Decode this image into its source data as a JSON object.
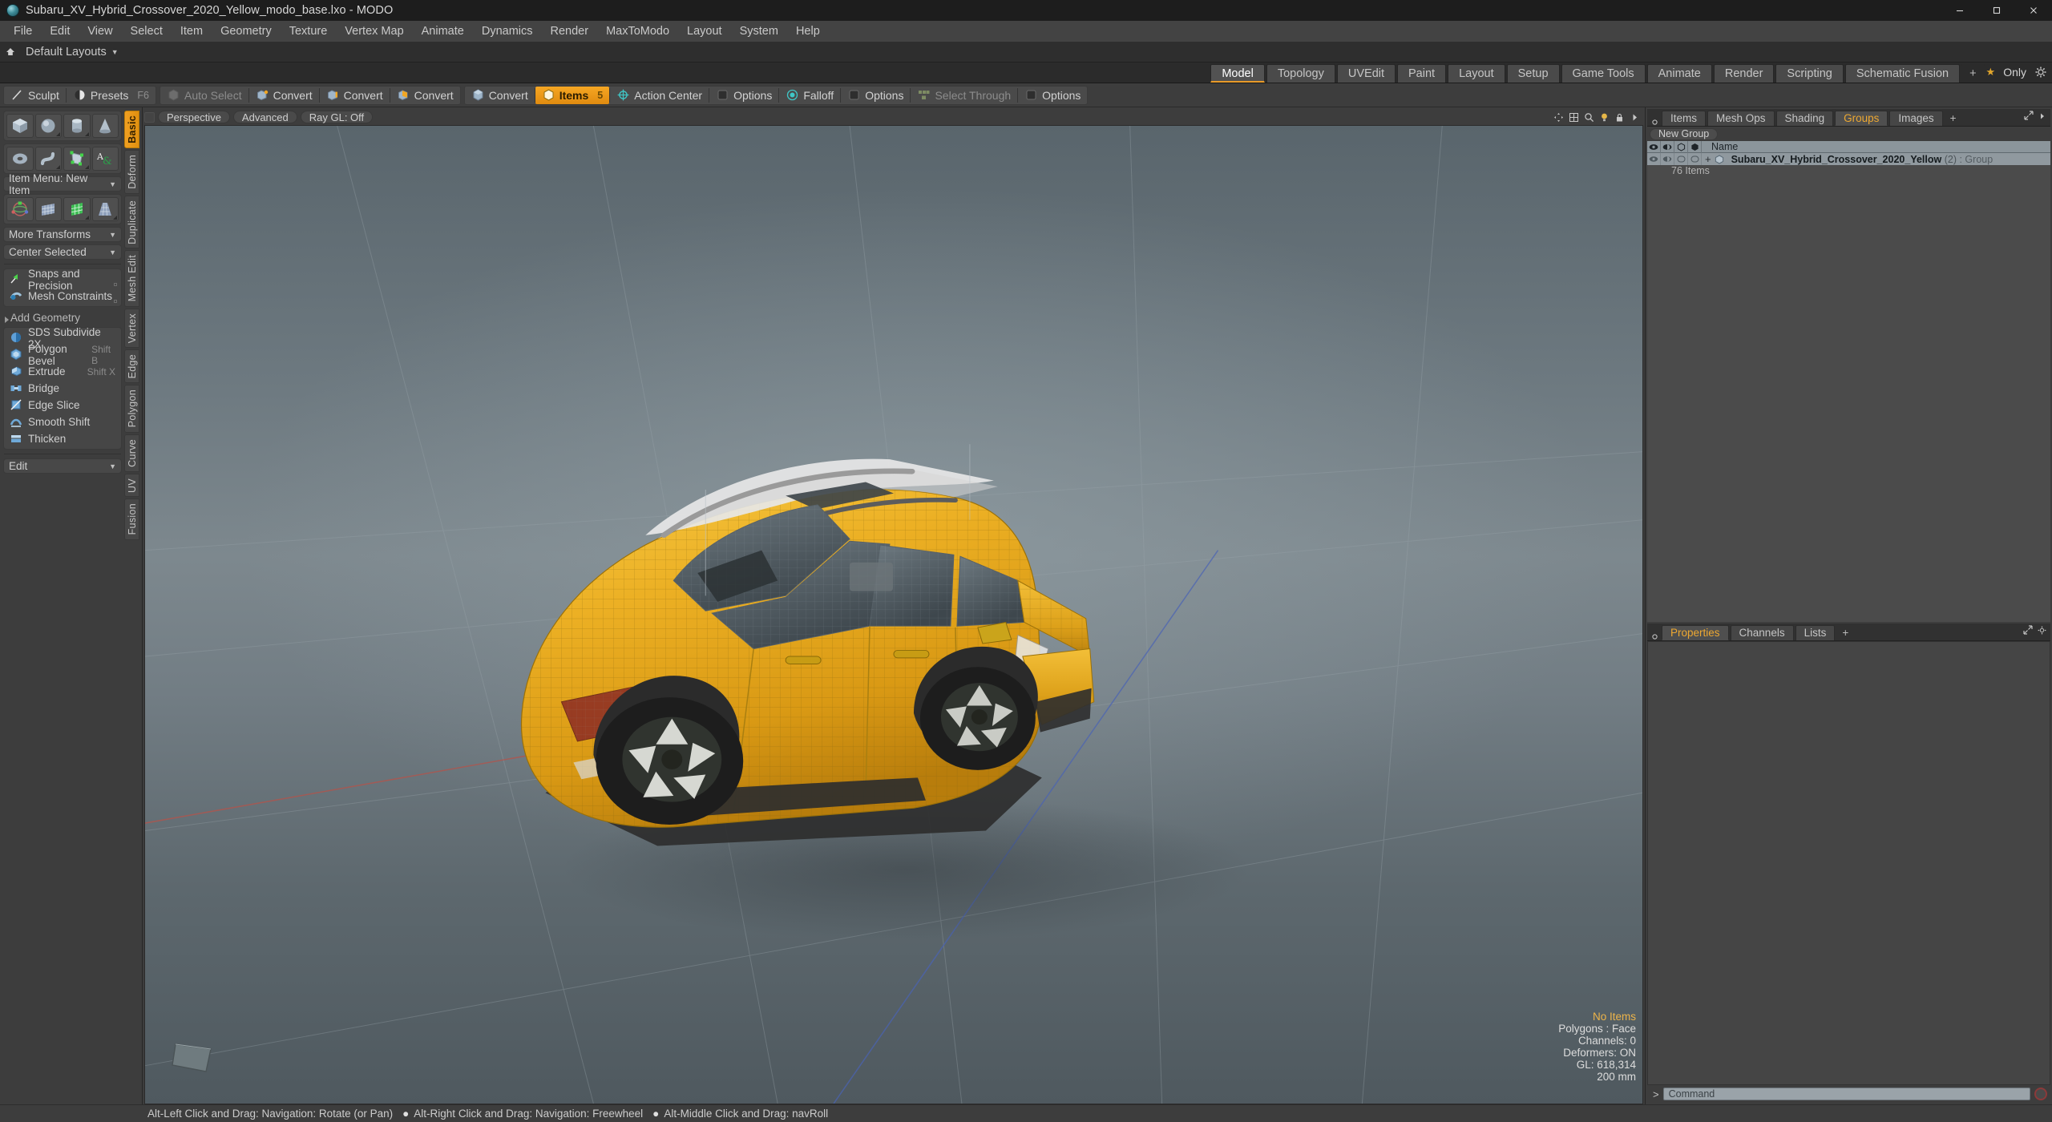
{
  "window": {
    "title": "Subaru_XV_Hybrid_Crossover_2020_Yellow_modo_base.lxo - MODO",
    "app_icon": "modo-logo-icon",
    "controls": {
      "minimize": "minimize-icon",
      "maximize": "maximize-icon",
      "close": "close-icon"
    }
  },
  "menubar": {
    "items": [
      "File",
      "Edit",
      "View",
      "Select",
      "Item",
      "Geometry",
      "Texture",
      "Vertex Map",
      "Animate",
      "Dynamics",
      "Render",
      "MaxToModo",
      "Layout",
      "System",
      "Help"
    ]
  },
  "layoutbar": {
    "home_icon": "home-icon",
    "label": "Default Layouts",
    "caret": "chevron-down-icon"
  },
  "tabstrip": {
    "tabs": [
      "Model",
      "Topology",
      "UVEdit",
      "Paint",
      "Layout",
      "Setup",
      "Game Tools",
      "Animate",
      "Render",
      "Scripting",
      "Schematic Fusion"
    ],
    "active": "Model",
    "add_label": "+",
    "only_label": "Only",
    "star_icon": "star-icon",
    "gear_icon": "gear-icon"
  },
  "toolbar": {
    "groups": [
      {
        "items": [
          {
            "label": "Sculpt",
            "icon": "sculpt-brush-icon",
            "state": "normal",
            "kbd": ""
          },
          {
            "label": "Presets",
            "icon": "presets-sphere-icon",
            "state": "normal",
            "kbd": "F6"
          }
        ]
      },
      {
        "items": [
          {
            "label": "Auto Select",
            "icon": "cube-grey-icon",
            "state": "dim",
            "kbd": ""
          },
          {
            "label": "Convert",
            "icon": "convert-vertex-icon",
            "state": "normal",
            "kbd": ""
          },
          {
            "label": "Convert",
            "icon": "convert-edge-icon",
            "state": "normal",
            "kbd": ""
          },
          {
            "label": "Convert",
            "icon": "convert-polygon-icon",
            "state": "normal",
            "kbd": ""
          }
        ]
      },
      {
        "items": [
          {
            "label": "Convert",
            "icon": "convert-item-icon",
            "state": "normal",
            "kbd": ""
          },
          {
            "label": "Items",
            "icon": "items-cube-icon",
            "state": "active",
            "kbd": "5"
          },
          {
            "label": "Action Center",
            "icon": "action-center-icon",
            "state": "normal",
            "kbd": ""
          },
          {
            "label": "Options",
            "icon": "options-square-icon",
            "state": "normal",
            "kbd": ""
          },
          {
            "label": "Falloff",
            "icon": "falloff-target-icon",
            "state": "normal",
            "kbd": ""
          },
          {
            "label": "Options",
            "icon": "options-square-icon",
            "state": "normal",
            "kbd": ""
          },
          {
            "label": "Select Through",
            "icon": "select-through-icon",
            "state": "dim",
            "kbd": ""
          },
          {
            "label": "Options",
            "icon": "options-square-icon",
            "state": "normal",
            "kbd": ""
          }
        ]
      }
    ]
  },
  "left_panel": {
    "primitive_tiles_row1": [
      "cube-icon",
      "sphere-icon",
      "cylinder-icon",
      "cone-icon"
    ],
    "primitive_tiles_row2": [
      "torus-icon",
      "tube-curve-icon",
      "polygon-pen-icon",
      "text-tool-icon"
    ],
    "item_menu": {
      "label": "Item Menu: New Item",
      "caret": "chevron-down-icon"
    },
    "transform_tiles": [
      "transform-gizmo-icon",
      "bend-grid-icon",
      "shear-grid-icon",
      "taper-grid-icon"
    ],
    "more_transforms": {
      "label": "More Transforms",
      "caret": "chevron-down-icon"
    },
    "center_selected": {
      "label": "Center Selected",
      "caret": "chevron-down-icon"
    },
    "snap_items": [
      {
        "label": "Snaps and Precision",
        "icon": "snap-arrow-icon"
      },
      {
        "label": "Mesh Constraints",
        "icon": "mesh-constraint-icon"
      }
    ],
    "add_geometry_label": "Add Geometry",
    "geometry_tools": [
      {
        "label": "SDS Subdivide 2X",
        "icon": "sds-subdivide-icon",
        "kbd": ""
      },
      {
        "label": "Polygon Bevel",
        "icon": "polygon-bevel-icon",
        "kbd": "Shift B"
      },
      {
        "label": "Extrude",
        "icon": "extrude-icon",
        "kbd": "Shift X"
      },
      {
        "label": "Bridge",
        "icon": "bridge-icon",
        "kbd": ""
      },
      {
        "label": "Edge Slice",
        "icon": "edge-slice-icon",
        "kbd": ""
      },
      {
        "label": "Smooth Shift",
        "icon": "smooth-shift-icon",
        "kbd": ""
      },
      {
        "label": "Thicken",
        "icon": "thicken-icon",
        "kbd": ""
      }
    ],
    "edit_dropdown": {
      "label": "Edit",
      "caret": "chevron-down-icon"
    },
    "vertical_tabs": [
      "Basic",
      "Deform",
      "Duplicate",
      "Mesh Edit",
      "Vertex",
      "Edge",
      "Polygon",
      "Curve",
      "UV",
      "Fusion"
    ],
    "vertical_active": "Basic"
  },
  "viewport": {
    "header_buttons": [
      "Perspective",
      "Advanced",
      "Ray GL: Off"
    ],
    "header_icons": [
      "move-view-icon",
      "grid-icon",
      "search-icon",
      "bulb-icon",
      "lock-icon",
      "chevron-right-icon"
    ],
    "status": {
      "selection": "No Items",
      "polygons": "Polygons : Face",
      "channels": "Channels: 0",
      "deformers": "Deformers: ON",
      "gl": "GL: 618,314",
      "scale": "200 mm"
    },
    "model_name": "Subaru XV Hybrid Crossover 2020 Yellow",
    "body_color": "#e8ad23",
    "background_top": "#59656c",
    "background_bottom": "#4f595f"
  },
  "right_panel": {
    "tabs": [
      "Items",
      "Mesh Ops",
      "Shading",
      "Groups",
      "Images"
    ],
    "active_tab": "Groups",
    "add_label": "+",
    "new_group_button": "New Group",
    "columns": [
      "visible-eye-icon",
      "render-eye-icon",
      "wire-cube-icon",
      "shaded-cube-icon",
      "Name"
    ],
    "name_header": "Name",
    "rows": [
      {
        "expander": "+",
        "icon": "group-cube-icon",
        "name": "Subaru_XV_Hybrid_Crossover_2020_Yellow",
        "count": "(2)",
        "type": ": Group",
        "sub": "76 Items"
      }
    ],
    "bottom_tabs": [
      "Properties",
      "Channels",
      "Lists"
    ],
    "bottom_active": "Properties",
    "bottom_add": "+",
    "command": {
      "prompt": ">",
      "placeholder": "Command",
      "record_icon": "record-icon"
    }
  },
  "helpbar": {
    "items": [
      "Alt-Left Click and Drag: Navigation: Rotate (or Pan)",
      "Alt-Right Click and Drag: Navigation: Freewheel",
      "Alt-Middle Click and Drag: navRoll"
    ]
  }
}
